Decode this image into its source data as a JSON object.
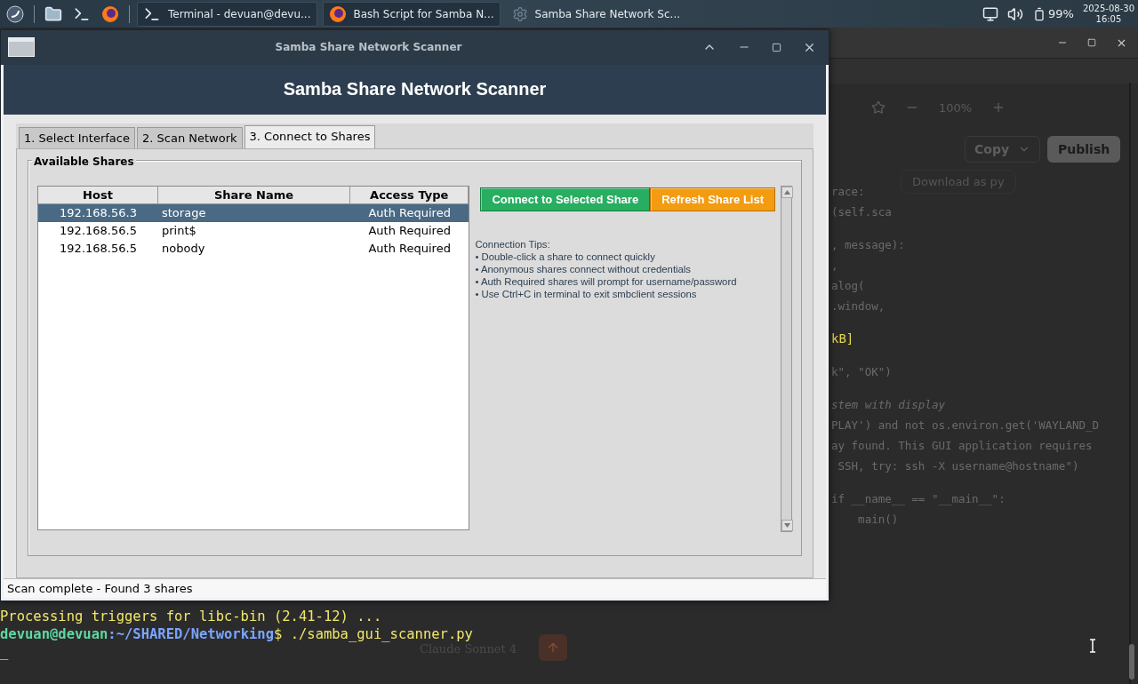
{
  "taskbar": {
    "launchers": [
      {
        "kind": "menu"
      },
      {
        "kind": "files"
      },
      {
        "kind": "terminal"
      },
      {
        "kind": "browser"
      }
    ],
    "tasks": [
      {
        "kind": "terminal",
        "label": "Terminal - devuan@devu...",
        "selected": false
      },
      {
        "kind": "browser",
        "label": "Bash Script for Samba N...",
        "selected": false
      },
      {
        "kind": "gear",
        "label": "Samba Share Network Sc...",
        "selected": true
      }
    ],
    "battery": "99%",
    "date": "2025-08-30",
    "time": "16:05"
  },
  "background": {
    "copy_button": "Copy",
    "publish_button": "Publish",
    "tooltip": "Download as py",
    "zoom": "100%",
    "code_blocks": [
      [
        {
          "kind": "code",
          "text": "race:"
        },
        {
          "kind": "code",
          "text": "(self.sca"
        }
      ],
      [
        {
          "kind": "code",
          "text": ", message):"
        },
        {
          "kind": "code",
          "text": ","
        },
        {
          "kind": "code",
          "text": "alog("
        },
        {
          "kind": "code",
          "text": ".window,"
        }
      ],
      [
        {
          "kind": "output",
          "text": "kB]"
        }
      ],
      [
        {
          "kind": "code",
          "text": "k\", \"OK\")"
        }
      ],
      [
        {
          "kind": "comment",
          "text": "stem with display"
        },
        {
          "kind": "code",
          "text": "PLAY') and not os.environ.get('WAYLAND_D"
        },
        {
          "kind": "code",
          "text": "ay found. This GUI application requires"
        },
        {
          "kind": "code",
          "text": " SSH, try: ssh -X username@hostname\")"
        }
      ],
      [
        {
          "kind": "code",
          "text": "if __name__ == \"__main__\":"
        },
        {
          "kind": "code",
          "text": "    main()"
        }
      ]
    ],
    "terminal_lines": [
      {
        "kind": "output",
        "text": "Processing triggers for libc-bin (2.41-12) ..."
      },
      {
        "kind": "prompt",
        "user": "devuan@devuan",
        "path": ":~/SHARED/Networking",
        "command": "$ ./samba_gui_scanner.py"
      },
      {
        "kind": "output",
        "text": "_"
      }
    ],
    "model_label": "Claude Sonnet 4"
  },
  "window": {
    "title": "Samba Share Network Scanner",
    "header": "Samba Share Network Scanner",
    "tabs": [
      {
        "label": "1. Select Interface",
        "selected": false
      },
      {
        "label": "2. Scan Network",
        "selected": false
      },
      {
        "label": "3. Connect to Shares",
        "selected": true
      }
    ],
    "group_title": "Available Shares",
    "table": {
      "columns": [
        "Host",
        "Share Name",
        "Access Type"
      ],
      "rows": [
        {
          "host": "192.168.56.3",
          "share": "storage",
          "access": "Auth Required",
          "selected": true
        },
        {
          "host": "192.168.56.5",
          "share": "print$",
          "access": "Auth Required",
          "selected": false
        },
        {
          "host": "192.168.56.5",
          "share": "nobody",
          "access": "Auth Required",
          "selected": false
        }
      ]
    },
    "buttons": [
      {
        "label": "Connect to Selected Share",
        "kind": "primary"
      },
      {
        "label": "Refresh Share List",
        "kind": "warning"
      }
    ],
    "tips": [
      "Connection Tips:",
      "• Double-click a share to connect quickly",
      "• Anonymous shares connect without credentials",
      "• Auth Required shares will prompt for username/password",
      "• Use Ctrl+C in terminal to exit smbclient sessions"
    ],
    "status_bar": "Scan complete - Found 3 shares"
  }
}
